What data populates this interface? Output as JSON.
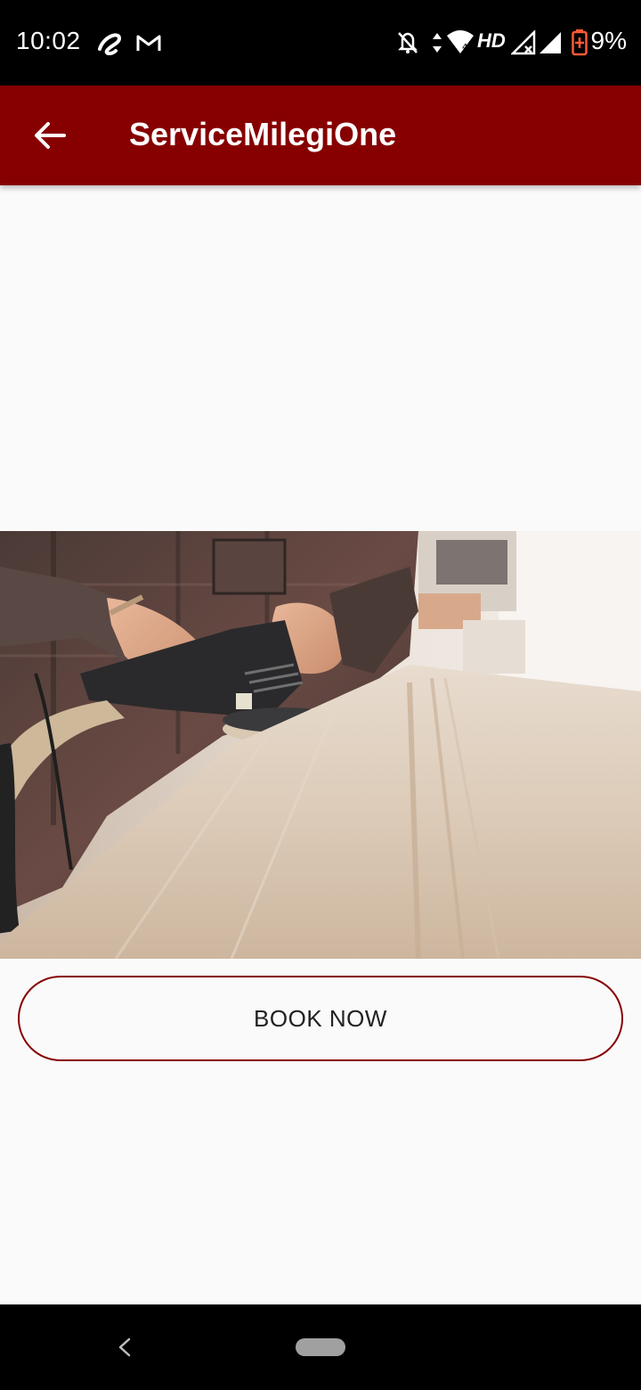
{
  "status_bar": {
    "time": "10:02",
    "network_label": "HD",
    "battery": "9%",
    "icons": [
      "airtel-icon",
      "gmail-icon",
      "notifications-off-icon",
      "data-arrows-icon",
      "wifi-icon",
      "signal-x-icon",
      "signal-icon",
      "battery-charging-icon"
    ]
  },
  "app_bar": {
    "back_icon": "arrow-left-icon",
    "title": "ServiceMilegiOne",
    "color": "#860000"
  },
  "hero": {
    "subject": "carpenter-sanding-wood-image"
  },
  "book_button": {
    "label": "BOOK NOW",
    "border_color": "#860000"
  },
  "nav_bar": {
    "back_icon": "nav-back-icon",
    "home_icon": "nav-home-pill"
  }
}
